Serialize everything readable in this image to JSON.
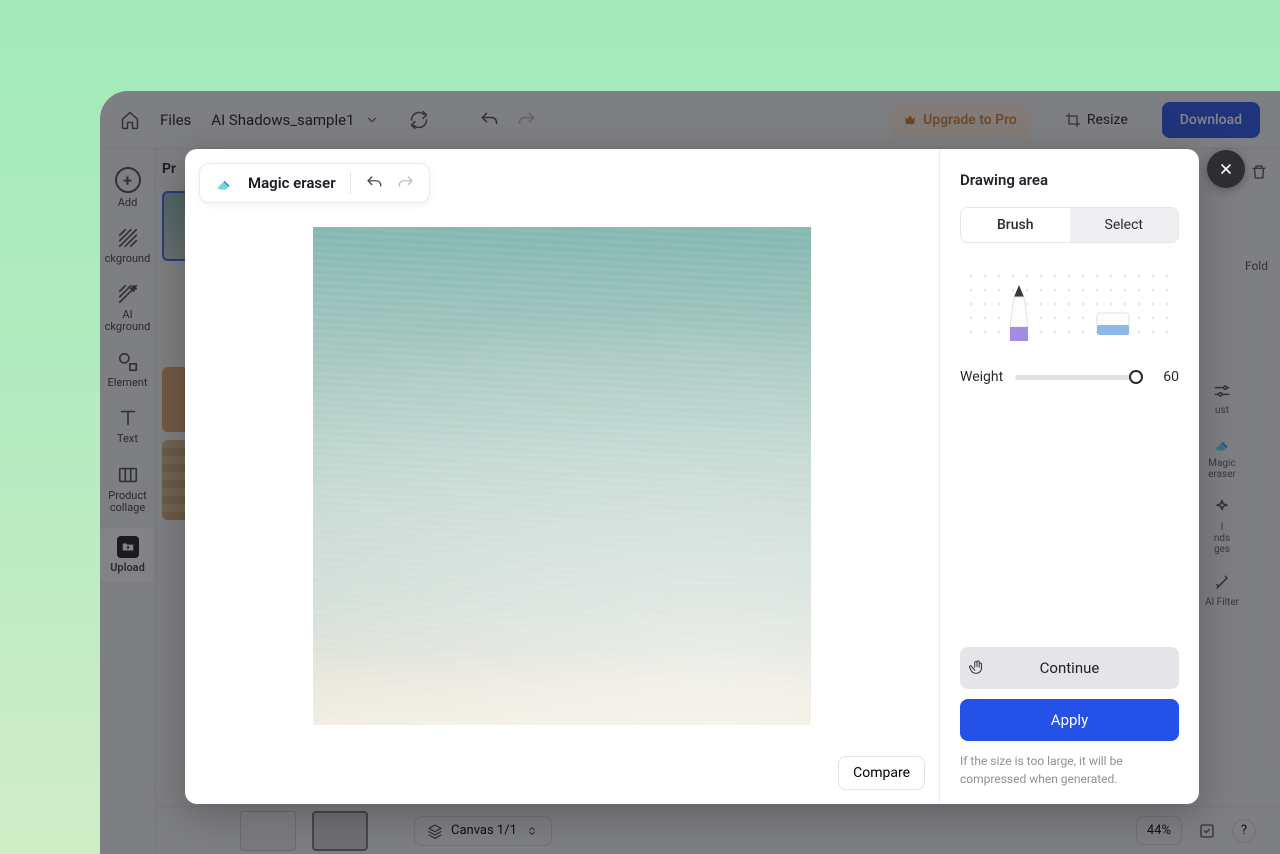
{
  "topbar": {
    "files": "Files",
    "project_name": "AI Shadows_sample1",
    "upgrade": "Upgrade to Pro",
    "resize": "Resize",
    "download": "Download"
  },
  "sidebar": {
    "add": "Add",
    "background": "ckground",
    "ai_background": "AI\nckground",
    "element": "Element",
    "text": "Text",
    "product_collage": "Product\ncollage",
    "upload": "Upload"
  },
  "right_panel": {
    "fold": "Fold",
    "tools": [
      {
        "label": "ust"
      },
      {
        "label": "Magic\neraser"
      },
      {
        "label": "I\nnds\nges"
      },
      {
        "label": "AI Filter"
      }
    ]
  },
  "bottombar": {
    "canvas": "Canvas 1/1",
    "zoom": "44%"
  },
  "modal": {
    "tool_name": "Magic eraser",
    "compare": "Compare",
    "panel_title": "Drawing area",
    "tab_brush": "Brush",
    "tab_select": "Select",
    "weight_label": "Weight",
    "weight_value": "60",
    "continue": "Continue",
    "apply": "Apply",
    "hint": "If the size is too large, it will be compressed when generated."
  }
}
